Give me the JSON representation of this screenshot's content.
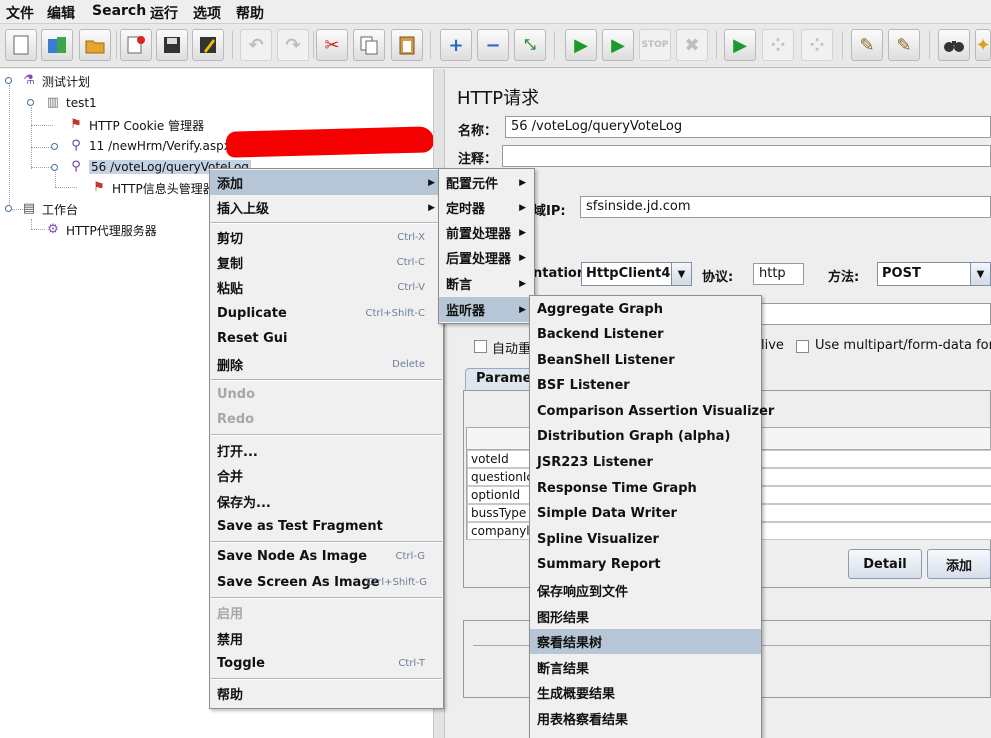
{
  "menubar": [
    "文件",
    "编辑",
    "Search",
    "运行",
    "选项",
    "帮助"
  ],
  "toolbar": {
    "icons": [
      "new-icon",
      "templates-icon",
      "open-icon",
      "close-icon",
      "save-icon",
      "save-as-icon",
      "undo-icon",
      "redo-icon",
      "cut-icon",
      "copy-icon",
      "paste-icon",
      "expand-icon",
      "collapse-icon",
      "toggle-icon",
      "start-icon",
      "start-no-pause-icon",
      "stop-icon",
      "shutdown-icon",
      "remote-start-icon",
      "remote-stop-icon",
      "remote-shutdown-icon",
      "clear-icon",
      "clear-all-icon",
      "search-icon",
      "reset-search-icon"
    ]
  },
  "tree": {
    "root": "测试计划",
    "group": "test1",
    "cookie": "HTTP Cookie 管理器",
    "req11": "11 /newHrm/Verify.aspx",
    "req56": "56 /voteLog/queryVoteLog",
    "header": "HTTP信息头管理器",
    "workbench": "工作台",
    "proxy": "HTTP代理服务器"
  },
  "panel": {
    "title": "HTTP请求",
    "name_label": "名称：",
    "name_value": "56 /voteLog/queryVoteLog",
    "comment_label": "注释：",
    "ip_label": "域IP:",
    "ip_value": "sfsinside.jd.com",
    "impl_label": "ntation:",
    "impl_value": "HttpClient4",
    "proto_label": "协议:",
    "proto_value": "http",
    "method_label": "方法:",
    "method_value": "POST",
    "redirect_label": "自动重",
    "keepalive_label": "live",
    "multipart_label": "Use multipart/form-data for P",
    "tab_label": "Paramet",
    "params": [
      "voteId",
      "questionIc",
      "optionId",
      "bussType",
      "companyl"
    ],
    "detail_btn": "Detail",
    "add_btn": "添加"
  },
  "ctx": {
    "items": [
      {
        "label": "添加",
        "accel": "",
        "sub": true
      },
      {
        "label": "插入上级",
        "accel": "",
        "sub": true
      },
      {
        "label": "剪切",
        "accel": "Ctrl-X"
      },
      {
        "label": "复制",
        "accel": "Ctrl-C"
      },
      {
        "label": "粘贴",
        "accel": "Ctrl-V"
      },
      {
        "label": "Duplicate",
        "accel": "Ctrl+Shift-C"
      },
      {
        "label": "Reset Gui",
        "accel": ""
      },
      {
        "label": "删除",
        "accel": "Delete"
      },
      {
        "label": "Undo",
        "accel": ""
      },
      {
        "label": "Redo",
        "accel": ""
      },
      {
        "label": "打开...",
        "accel": ""
      },
      {
        "label": "合并",
        "accel": ""
      },
      {
        "label": "保存为...",
        "accel": ""
      },
      {
        "label": "Save as Test Fragment",
        "accel": ""
      },
      {
        "label": "Save Node As Image",
        "accel": "Ctrl-G"
      },
      {
        "label": "Save Screen As Image",
        "accel": "Ctrl+Shift-G"
      },
      {
        "label": "启用",
        "accel": ""
      },
      {
        "label": "禁用",
        "accel": ""
      },
      {
        "label": "Toggle",
        "accel": "Ctrl-T"
      },
      {
        "label": "帮助",
        "accel": ""
      }
    ]
  },
  "addmenu": [
    "配置元件",
    "定时器",
    "前置处理器",
    "后置处理器",
    "断言",
    "监听器"
  ],
  "listeners": [
    "Aggregate Graph",
    "Backend Listener",
    "BeanShell Listener",
    "BSF Listener",
    "Comparison Assertion Visualizer",
    "Distribution Graph (alpha)",
    "JSR223 Listener",
    "Response Time Graph",
    "Simple Data Writer",
    "Spline Visualizer",
    "Summary Report",
    "保存响应到文件",
    "图形结果",
    "察看结果树",
    "断言结果",
    "生成概要结果",
    "用表格察看结果"
  ]
}
